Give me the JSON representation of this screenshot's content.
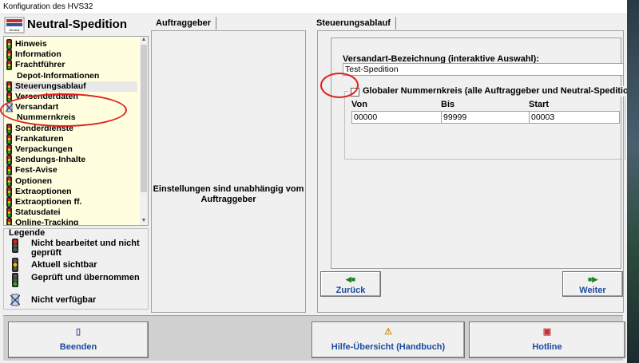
{
  "window": {
    "title": "Konfiguration des HVS32"
  },
  "app": {
    "title": "Neutral-Spedition",
    "logo_text": "Neutral Spedition"
  },
  "sidebar": {
    "items": [
      {
        "label": "Hinweis",
        "icon": "traffic-light-icon",
        "sub": false,
        "selected": false
      },
      {
        "label": "Information",
        "icon": "traffic-light-icon",
        "sub": false,
        "selected": false
      },
      {
        "label": "Frachtführer",
        "icon": "traffic-light-icon",
        "sub": false,
        "selected": false
      },
      {
        "label": "Depot-Informationen",
        "icon": "",
        "sub": true,
        "selected": false
      },
      {
        "label": "Steuerungsablauf",
        "icon": "traffic-light-icon",
        "sub": false,
        "selected": true
      },
      {
        "label": "Versenderdaten",
        "icon": "traffic-light-icon",
        "sub": false,
        "selected": false
      },
      {
        "label": "Versandart",
        "icon": "unavailable-icon",
        "sub": false,
        "selected": false
      },
      {
        "label": "Nummernkreis",
        "icon": "",
        "sub": true,
        "selected": false
      },
      {
        "label": "Sonderdienste",
        "icon": "traffic-light-icon",
        "sub": false,
        "selected": false
      },
      {
        "label": "Frankaturen",
        "icon": "traffic-light-icon",
        "sub": false,
        "selected": false
      },
      {
        "label": "Verpackungen",
        "icon": "traffic-light-icon",
        "sub": false,
        "selected": false
      },
      {
        "label": "Sendungs-Inhalte",
        "icon": "traffic-light-icon",
        "sub": false,
        "selected": false
      },
      {
        "label": "Fest-Avise",
        "icon": "traffic-light-icon",
        "sub": false,
        "selected": false
      },
      {
        "label": "Optionen",
        "icon": "traffic-light-icon",
        "sub": false,
        "selected": false
      },
      {
        "label": "Extraoptionen",
        "icon": "traffic-light-icon",
        "sub": false,
        "selected": false
      },
      {
        "label": "Extraoptionen ff.",
        "icon": "traffic-light-icon",
        "sub": false,
        "selected": false
      },
      {
        "label": "Statusdatei",
        "icon": "traffic-light-icon",
        "sub": false,
        "selected": false
      },
      {
        "label": "Online-Tracking",
        "icon": "traffic-light-icon",
        "sub": false,
        "selected": false
      }
    ]
  },
  "legend": {
    "title": "Legende",
    "rows": [
      {
        "text": "Nicht bearbeitet und nicht geprüft",
        "icon": "red-light-icon"
      },
      {
        "text": "Aktuell sichtbar",
        "icon": "yellow-light-icon"
      },
      {
        "text": "Geprüft und übernommen",
        "icon": "green-light-icon"
      },
      {
        "text": "Nicht verfügbar",
        "icon": "unavailable-icon"
      }
    ]
  },
  "middle": {
    "tab_label": "Auftraggeber",
    "info_line1": "Einstellungen sind unabhängig vom",
    "info_line2": "Auftraggeber"
  },
  "right": {
    "tab_label": "Steuerungsablauf",
    "versandart_label": "Versandart-Bezeichnung (interaktive Auswahl):",
    "versandart_value": "Test-Spedition",
    "group_checkbox_label": "Globaler Nummernkreis (alle Auftraggeber und Neutral-Speditionen)",
    "group_checked": true,
    "columns": [
      {
        "label": "Von",
        "value": "00000"
      },
      {
        "label": "Bis",
        "value": "99999"
      },
      {
        "label": "Start",
        "value": "00003"
      }
    ],
    "back_button": "Zurück",
    "next_button": "Weiter"
  },
  "bottom": {
    "exit_button": "Beenden",
    "help_button": "Hilfe-Übersicht (Handbuch)",
    "hotline_button": "Hotline"
  },
  "colors": {
    "accent_text": "#1a4aa0",
    "list_bg": "#ffffe0",
    "annotation": "#e02020"
  }
}
